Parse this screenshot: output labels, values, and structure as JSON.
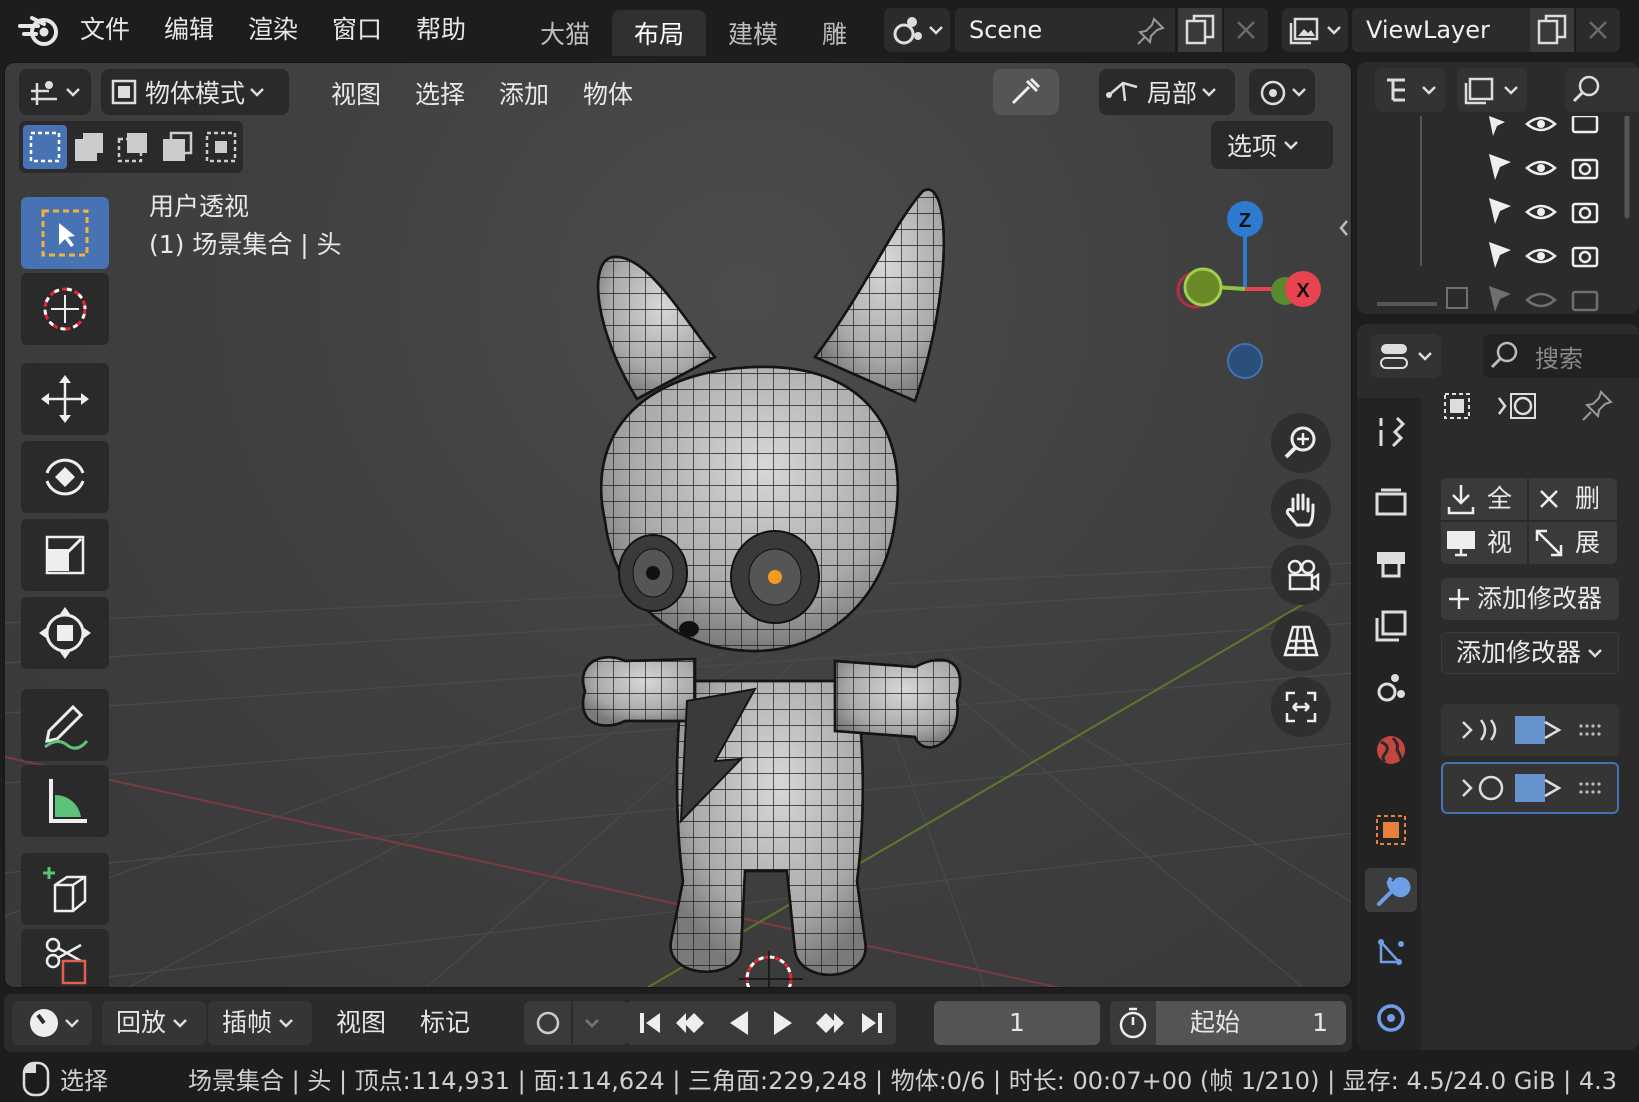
{
  "topbar": {
    "menus": [
      "文件",
      "编辑",
      "渲染",
      "窗口",
      "帮助"
    ],
    "workspace_tabs": [
      "大猫",
      "布局",
      "建模",
      "雕刻"
    ],
    "active_tab": "布局",
    "scene_name": "Scene",
    "view_layer": "ViewLayer"
  },
  "viewport_header": {
    "mode": "物体模式",
    "menus": [
      "视图",
      "选择",
      "添加",
      "物体"
    ],
    "transform_orientation": "局部",
    "options": "选项"
  },
  "viewport_overlay": {
    "view_name": "用户透视",
    "collection_info": "(1) 场景集合 | 头"
  },
  "gizmo": {
    "z": "Z",
    "x": "X"
  },
  "timeline": {
    "playback": "回放",
    "keying": "插帧",
    "view": "视图",
    "marker": "标记",
    "current_frame": "1",
    "start_label": "起始",
    "start_value": "1"
  },
  "statusbar": {
    "select": "选择",
    "info": "场景集合 | 头 | 顶点:114,931 | 面:114,624 | 三角面:229,248 | 物体:0/6 | 时长: 00:07+00 (帧 1/210) | 显存: 4.5/24.0 GiB | 4.3"
  },
  "properties": {
    "search_placeholder": "搜索",
    "apply_all": "全",
    "delete_all": "删",
    "viewport": "视",
    "expand": "展",
    "add_modifier_button": "添加修改器",
    "add_modifier_dropdown": "添加修改器"
  },
  "colors": {
    "accent": "#4772b3",
    "x_axis": "#e8434f",
    "y_axis": "#8ec53c",
    "z_axis": "#2d7ad1"
  }
}
